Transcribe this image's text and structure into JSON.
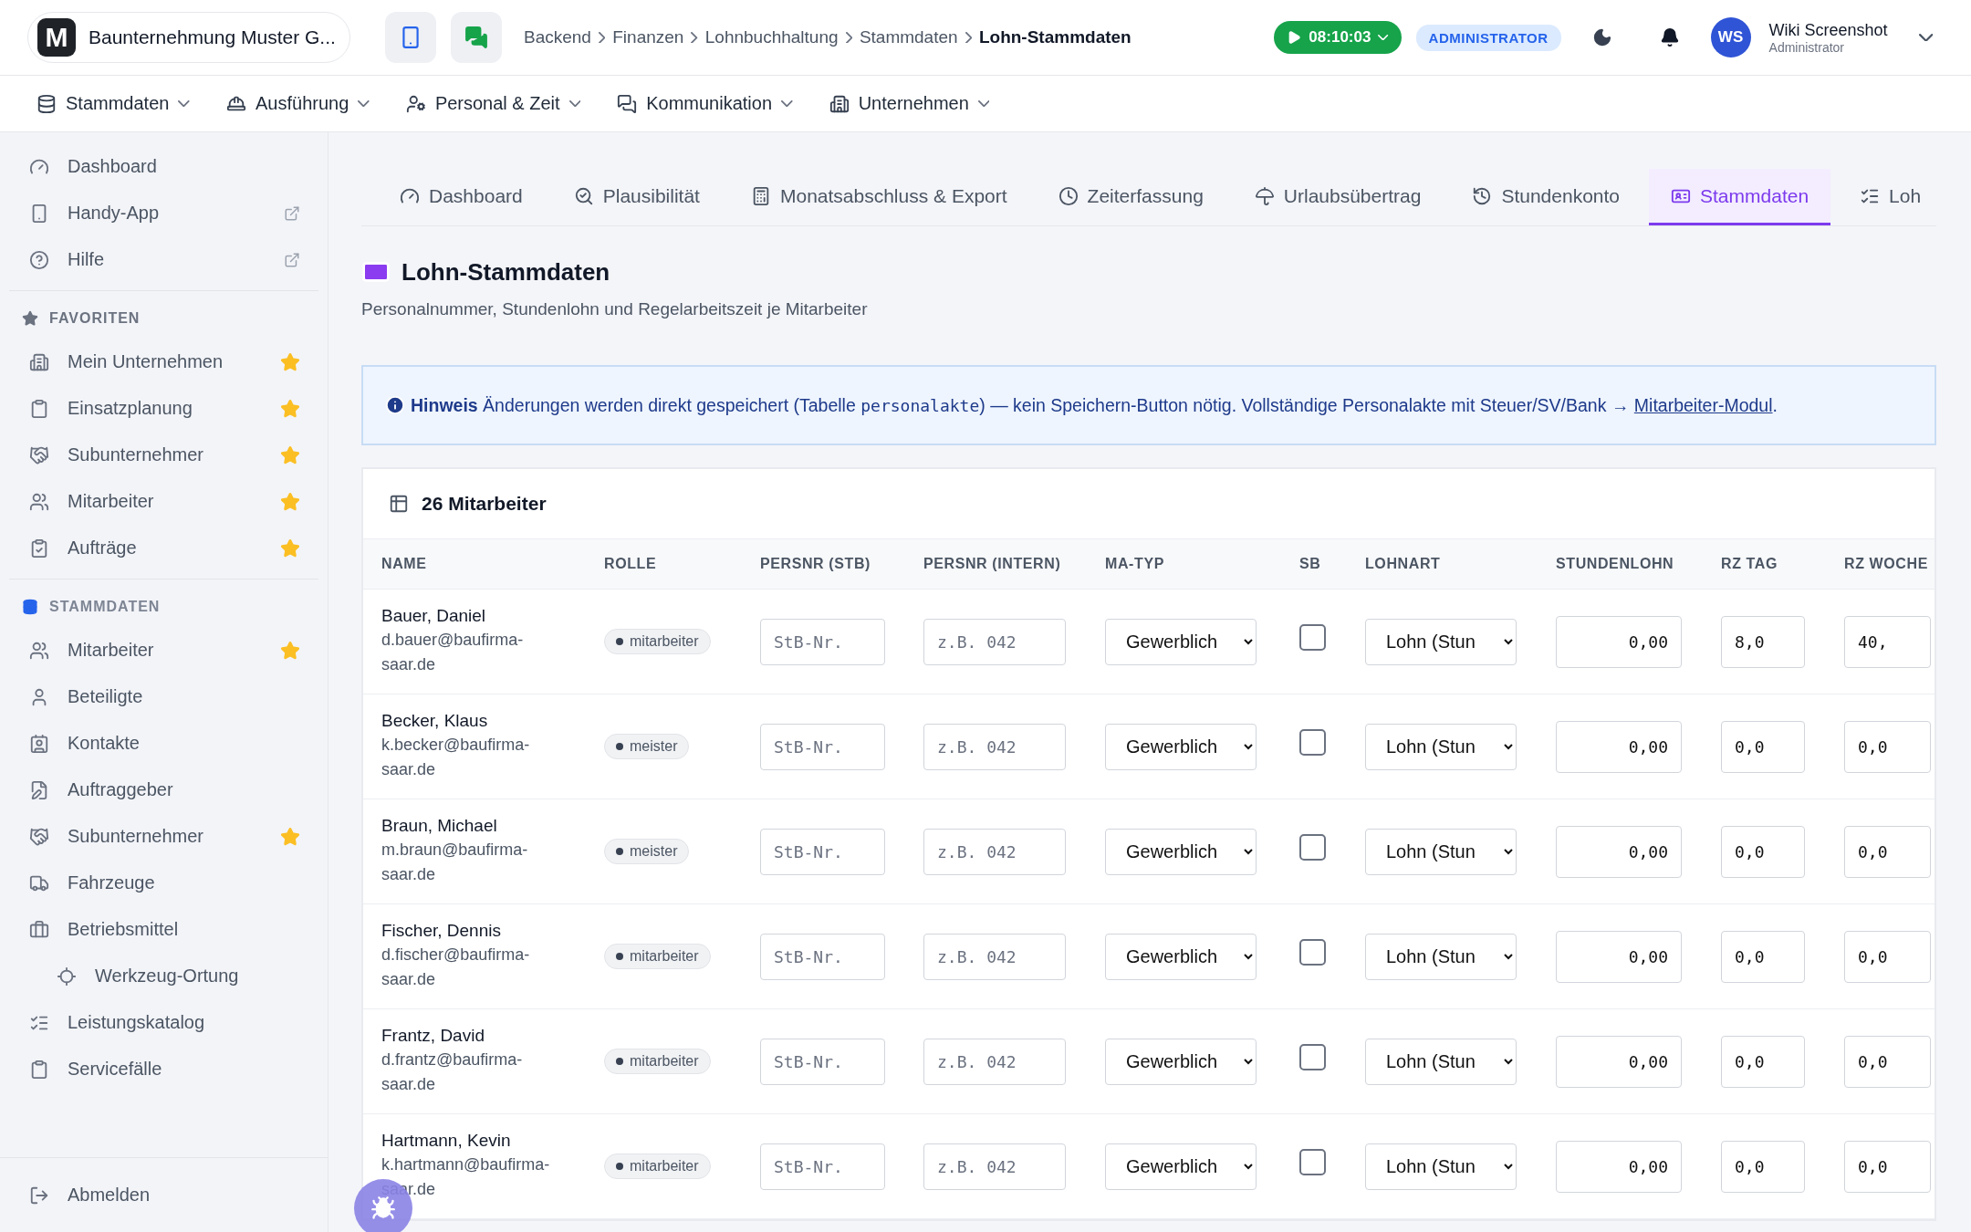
{
  "app": {
    "logo": "M",
    "company": "Baunternehmung Muster G..."
  },
  "breadcrumb": [
    {
      "label": "Backend",
      "selected": false
    },
    {
      "label": "Finanzen",
      "selected": false
    },
    {
      "label": "Lohnbuchhaltung",
      "selected": false
    },
    {
      "label": "Stammdaten",
      "selected": false
    },
    {
      "label": "Lohn-Stammdaten",
      "selected": true
    }
  ],
  "timer": "08:10:03",
  "role_badge": "ADMINISTRATOR",
  "user": {
    "initials": "WS",
    "name": "Wiki Screenshot",
    "role": "Administrator"
  },
  "main_nav": [
    {
      "label": "Stammdaten"
    },
    {
      "label": "Ausführung"
    },
    {
      "label": "Personal & Zeit"
    },
    {
      "label": "Kommunikation"
    },
    {
      "label": "Unternehmen"
    }
  ],
  "sidebar": {
    "top_items": [
      {
        "label": "Dashboard",
        "external": false
      },
      {
        "label": "Handy-App",
        "external": true
      },
      {
        "label": "Hilfe",
        "external": true
      }
    ],
    "sections": [
      {
        "title": "FAVORITEN",
        "items": [
          {
            "label": "Mein Unternehmen",
            "starred": true
          },
          {
            "label": "Einsatzplanung",
            "starred": true
          },
          {
            "label": "Subunternehmer",
            "starred": true
          },
          {
            "label": "Mitarbeiter",
            "starred": true
          },
          {
            "label": "Aufträge",
            "starred": true
          }
        ]
      },
      {
        "title": "STAMMDATEN",
        "items": [
          {
            "label": "Mitarbeiter",
            "starred": true
          },
          {
            "label": "Beteiligte",
            "starred": false
          },
          {
            "label": "Kontakte",
            "starred": false
          },
          {
            "label": "Auftraggeber",
            "starred": false
          },
          {
            "label": "Subunternehmer",
            "starred": true
          },
          {
            "label": "Fahrzeuge",
            "starred": false
          },
          {
            "label": "Betriebsmittel",
            "starred": false,
            "children": [
              {
                "label": "Werkzeug-Ortung",
                "starred": false
              }
            ]
          },
          {
            "label": "Leistungskatalog",
            "starred": false
          },
          {
            "label": "Servicefälle",
            "starred": false
          }
        ]
      }
    ],
    "footer": "Abmelden"
  },
  "tabs": [
    {
      "label": "Dashboard",
      "selected": false
    },
    {
      "label": "Plausibilität",
      "selected": false
    },
    {
      "label": "Monatsabschluss & Export",
      "selected": false
    },
    {
      "label": "Zeiterfassung",
      "selected": false
    },
    {
      "label": "Urlaubsübertrag",
      "selected": false
    },
    {
      "label": "Stundenkonto",
      "selected": false
    },
    {
      "label": "Stammdaten",
      "selected": true
    },
    {
      "label": "Loh",
      "selected": false
    }
  ],
  "page": {
    "title": "Lohn-Stammdaten",
    "subtitle": "Personalnummer, Stundenlohn und Regelarbeitszeit je Mitarbeiter"
  },
  "notice": {
    "label": "Hinweis",
    "text_before": "Änderungen werden direkt gespeichert (Tabelle ",
    "code": "personalakte",
    "text_after": ") — kein Speichern-Button nötig. Vollständige Personalakte mit Steuer/SV/Bank → ",
    "link": "Mitarbeiter-Modul",
    "end": "."
  },
  "table": {
    "title": "26 Mitarbeiter",
    "columns": [
      "NAME",
      "ROLLE",
      "PERSNR (STB)",
      "PERSNR (INTERN)",
      "MA-TYP",
      "SB",
      "LOHNART",
      "STUNDENLOHN",
      "RZ TAG",
      "RZ WOCHE"
    ],
    "rows": [
      {
        "name": "Bauer, Daniel",
        "email": "d.bauer@baufirma-saar.de",
        "role": "mitarbeiter",
        "persnr_stb": {
          "placeholder": "StB-Nr."
        },
        "persnr_intern": {
          "placeholder": "z.B. 042"
        },
        "ma_typ": "Gewerblich",
        "sb": false,
        "lohnart": "Lohn (Stun",
        "stundenlohn": "0,00",
        "rz_tag": "8,0",
        "rz_woche": "40,"
      },
      {
        "name": "Becker, Klaus",
        "email": "k.becker@baufirma-saar.de",
        "role": "meister",
        "persnr_stb": {
          "placeholder": "StB-Nr."
        },
        "persnr_intern": {
          "placeholder": "z.B. 042"
        },
        "ma_typ": "Gewerblich",
        "sb": false,
        "lohnart": "Lohn (Stun",
        "stundenlohn": "0,00",
        "rz_tag": "0,0",
        "rz_woche": "0,0"
      },
      {
        "name": "Braun, Michael",
        "email": "m.braun@baufirma-saar.de",
        "role": "meister",
        "persnr_stb": {
          "placeholder": "StB-Nr."
        },
        "persnr_intern": {
          "placeholder": "z.B. 042"
        },
        "ma_typ": "Gewerblich",
        "sb": false,
        "lohnart": "Lohn (Stun",
        "stundenlohn": "0,00",
        "rz_tag": "0,0",
        "rz_woche": "0,0"
      },
      {
        "name": "Fischer, Dennis",
        "email": "d.fischer@baufirma-saar.de",
        "role": "mitarbeiter",
        "persnr_stb": {
          "placeholder": "StB-Nr."
        },
        "persnr_intern": {
          "placeholder": "z.B. 042"
        },
        "ma_typ": "Gewerblich",
        "sb": false,
        "lohnart": "Lohn (Stun",
        "stundenlohn": "0,00",
        "rz_tag": "0,0",
        "rz_woche": "0,0"
      },
      {
        "name": "Frantz, David",
        "email": "d.frantz@baufirma-saar.de",
        "role": "mitarbeiter",
        "persnr_stb": {
          "placeholder": "StB-Nr."
        },
        "persnr_intern": {
          "placeholder": "z.B. 042"
        },
        "ma_typ": "Gewerblich",
        "sb": false,
        "lohnart": "Lohn (Stun",
        "stundenlohn": "0,00",
        "rz_tag": "0,0",
        "rz_woche": "0,0"
      },
      {
        "name": "Hartmann, Kevin",
        "email": "k.hartmann@baufirma-saar.de",
        "role": "mitarbeiter",
        "persnr_stb": {
          "placeholder": "StB-Nr."
        },
        "persnr_intern": {
          "placeholder": "z.B. 042"
        },
        "ma_typ": "Gewerblich",
        "sb": false,
        "lohnart": "Lohn (Stun",
        "stundenlohn": "0,00",
        "rz_tag": "0,0",
        "rz_woche": "0,0"
      }
    ]
  }
}
